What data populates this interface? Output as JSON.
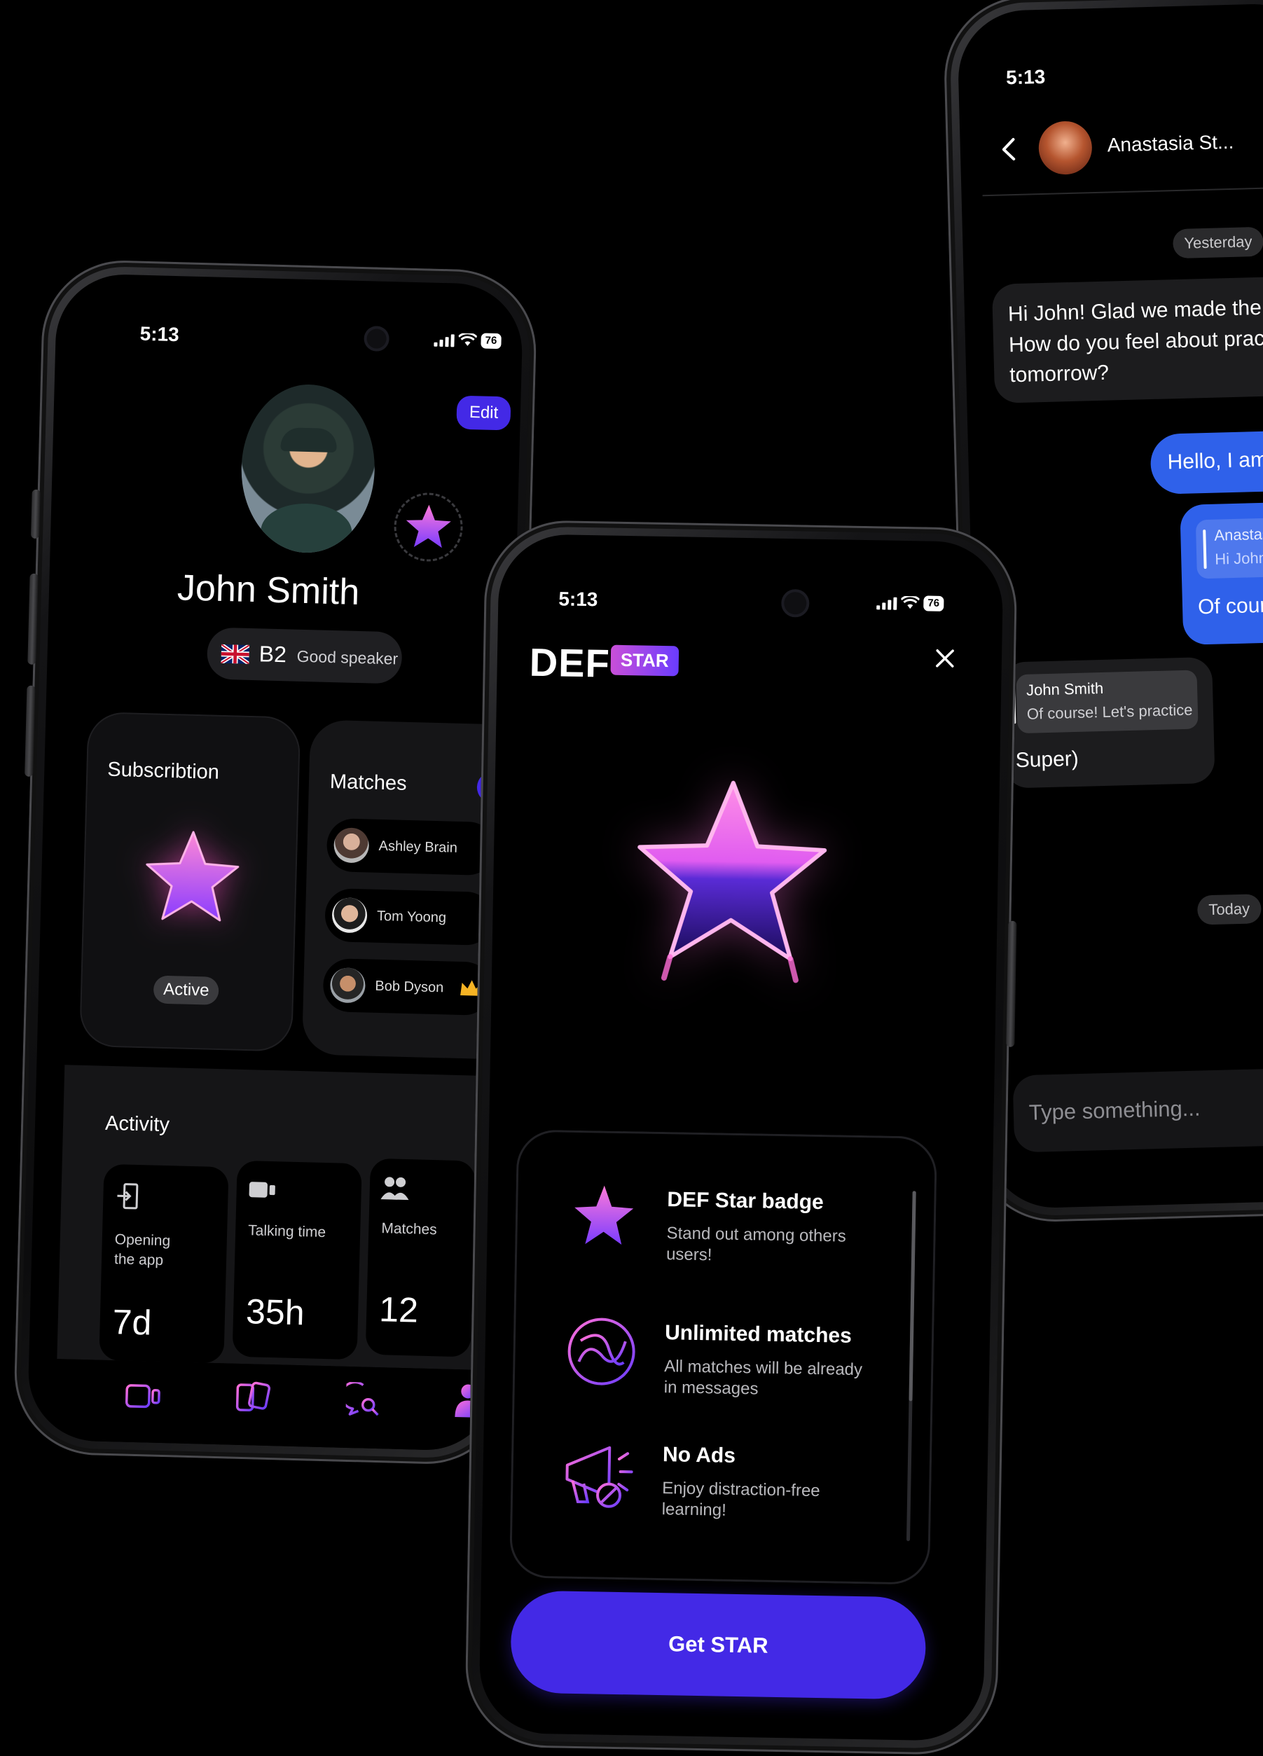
{
  "status": {
    "time": "5:13",
    "battery": "76"
  },
  "profile": {
    "edit_label": "Edit",
    "name": "John Smith",
    "level": "B2",
    "level_desc": "Good speaker",
    "subscription": {
      "title": "Subscribtion",
      "status": "Active"
    },
    "matches": {
      "title": "Matches",
      "items": [
        {
          "name": "Ashley Brain"
        },
        {
          "name": "Tom Yoong"
        },
        {
          "name": "Bob Dyson"
        }
      ]
    },
    "activity": {
      "title": "Activity",
      "tiles": [
        {
          "label": "Opening\nthe app",
          "value": "7d"
        },
        {
          "label": "Talking time",
          "value": "35h"
        },
        {
          "label": "Matches",
          "value": "12"
        }
      ]
    },
    "nav": [
      "video-call-icon",
      "cards-icon",
      "chat-search-icon",
      "profile-icon"
    ]
  },
  "chat": {
    "contact_name": "Anastasia St...",
    "date_yesterday": "Yesterday",
    "msg_in_1": "Hi John! Glad we made the m\nHow do you feel about practic\ntomorrow?",
    "msg_out_1": "Hello, I am a",
    "reply_quote_name": "Anastasi",
    "reply_quote_text": "Hi John! G",
    "msg_out_2": "Of course",
    "quote_name": "John Smith",
    "quote_text": "Of course! Let's practice",
    "msg_in_2": "Super)",
    "date_today": "Today",
    "input_placeholder": "Type something..."
  },
  "paywall": {
    "brand": "DEF",
    "badge": "STAR",
    "features": [
      {
        "title": "DEF Star badge",
        "desc": "Stand out among others\nusers!"
      },
      {
        "title": "Unlimited matches",
        "desc": "All matches will be already\nin messages"
      },
      {
        "title": "No Ads",
        "desc": "Enjoy distraction-free\nlearning!"
      }
    ],
    "cta": "Get STAR"
  },
  "colors": {
    "accent": "#4329e6",
    "chat_blue": "#2f61ea",
    "star_pink": "#ff6fd8",
    "star_purple": "#7a3cff"
  }
}
